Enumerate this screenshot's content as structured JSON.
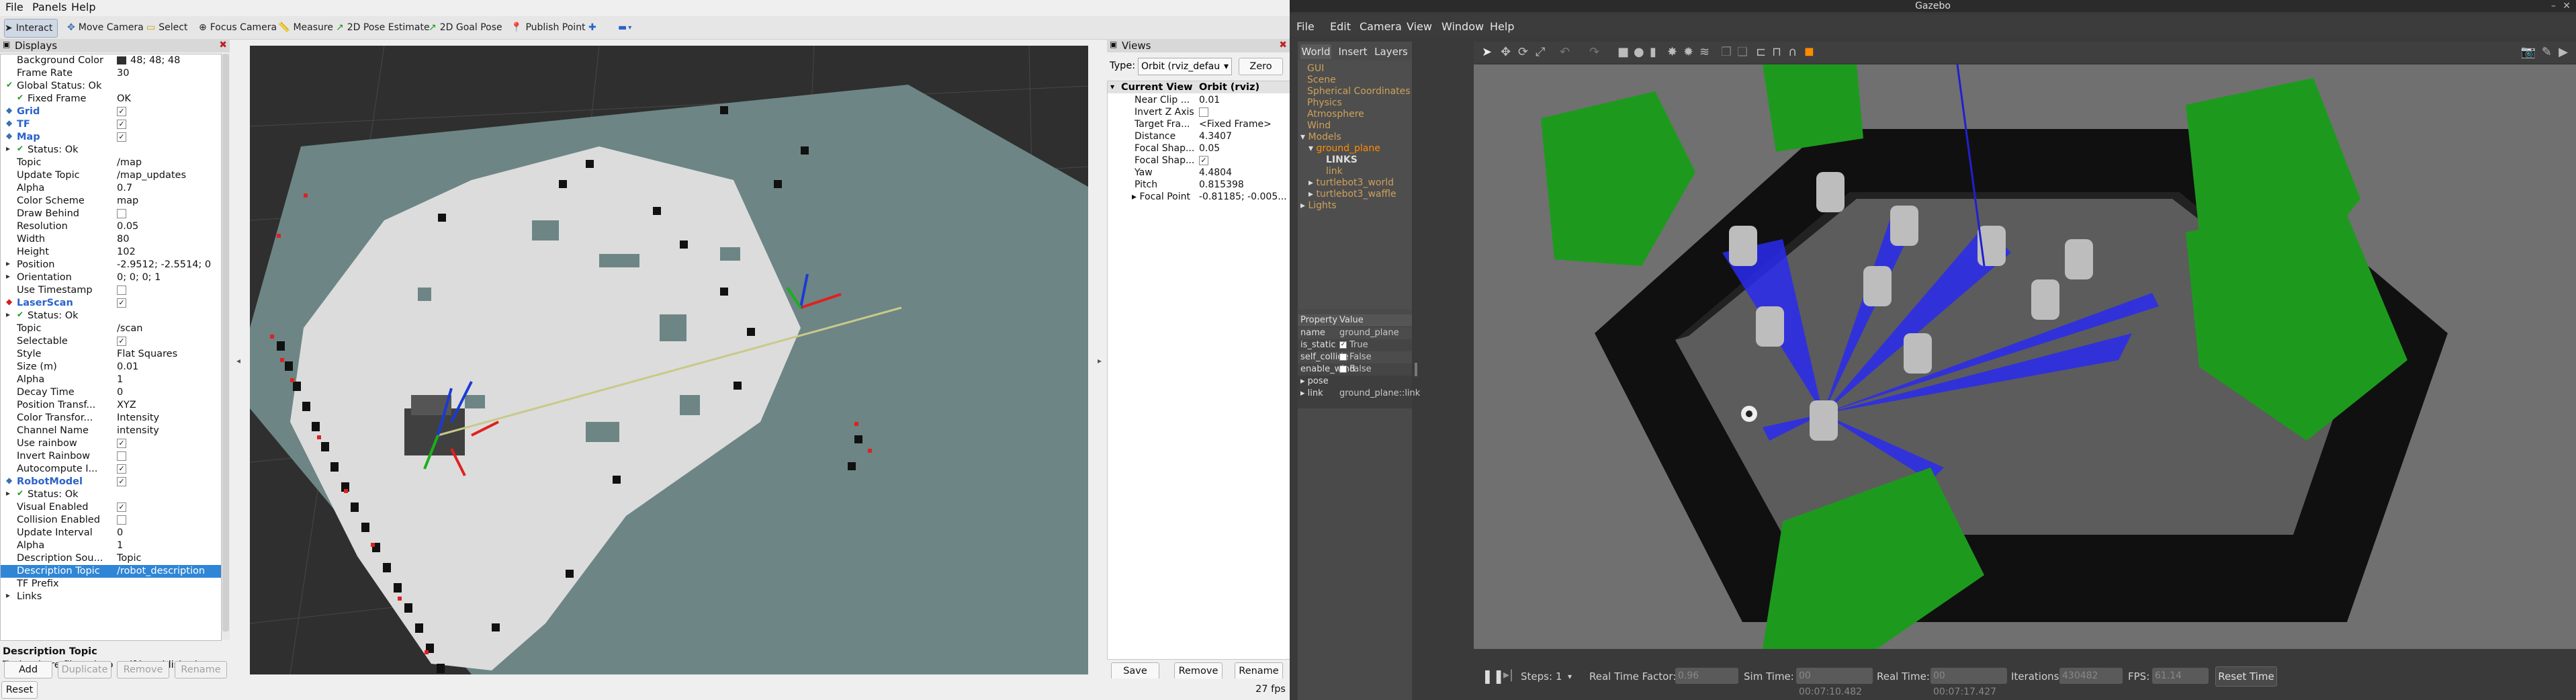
{
  "rviz": {
    "menu": [
      "File",
      "Panels",
      "Help"
    ],
    "tools": [
      {
        "label": "Interact",
        "icon": "cursor-icon",
        "active": true
      },
      {
        "label": "Move Camera",
        "icon": "move-camera-icon"
      },
      {
        "label": "Select",
        "icon": "select-icon"
      },
      {
        "label": "Focus Camera",
        "icon": "focus-camera-icon"
      },
      {
        "label": "Measure",
        "icon": "measure-icon"
      },
      {
        "label": "2D Pose Estimate",
        "icon": "pose-estimate-arrow-icon"
      },
      {
        "label": "2D Goal Pose",
        "icon": "goal-pose-arrow-icon"
      },
      {
        "label": "Publish Point",
        "icon": "map-pin-icon"
      }
    ],
    "displays": {
      "title": "Displays",
      "rows": [
        {
          "key": "Background Color",
          "value": "48; 48; 48",
          "swatch": "#303030"
        },
        {
          "key": "Frame Rate",
          "value": "30"
        },
        {
          "key": "Global Status: Ok",
          "value": ""
        },
        {
          "key": "Fixed Frame",
          "value": "OK"
        },
        {
          "key": "Grid",
          "value": "",
          "checked": true
        },
        {
          "key": "TF",
          "value": "",
          "checked": true
        },
        {
          "key": "Map",
          "value": "",
          "checked": true
        },
        {
          "key": "Status: Ok",
          "value": ""
        },
        {
          "key": "Topic",
          "value": "/map"
        },
        {
          "key": "Update Topic",
          "value": "/map_updates"
        },
        {
          "key": "Alpha",
          "value": "0.7"
        },
        {
          "key": "Color Scheme",
          "value": "map"
        },
        {
          "key": "Draw Behind",
          "value": "",
          "checked": false
        },
        {
          "key": "Resolution",
          "value": "0.05"
        },
        {
          "key": "Width",
          "value": "80"
        },
        {
          "key": "Height",
          "value": "102"
        },
        {
          "key": "Position",
          "value": "-2.9512; -2.5514; 0"
        },
        {
          "key": "Orientation",
          "value": "0; 0; 0; 1"
        },
        {
          "key": "Use Timestamp",
          "value": "",
          "checked": false
        },
        {
          "key": "LaserScan",
          "value": "",
          "checked": true
        },
        {
          "key": "Status: Ok",
          "value": ""
        },
        {
          "key": "Topic",
          "value": "/scan"
        },
        {
          "key": "Selectable",
          "value": "",
          "checked": true
        },
        {
          "key": "Style",
          "value": "Flat Squares"
        },
        {
          "key": "Size (m)",
          "value": "0.01"
        },
        {
          "key": "Alpha",
          "value": "1"
        },
        {
          "key": "Decay Time",
          "value": "0"
        },
        {
          "key": "Position Transf...",
          "value": "XYZ"
        },
        {
          "key": "Color Transfor...",
          "value": "Intensity"
        },
        {
          "key": "Channel Name",
          "value": "intensity"
        },
        {
          "key": "Use rainbow",
          "value": "",
          "checked": true
        },
        {
          "key": "Invert Rainbow",
          "value": "",
          "checked": false
        },
        {
          "key": "Autocompute I...",
          "value": "",
          "checked": true
        },
        {
          "key": "RobotModel",
          "value": "",
          "checked": true
        },
        {
          "key": "Status: Ok",
          "value": ""
        },
        {
          "key": "Visual Enabled",
          "value": "",
          "checked": true
        },
        {
          "key": "Collision Enabled",
          "value": "",
          "checked": false
        },
        {
          "key": "Update Interval",
          "value": "0"
        },
        {
          "key": "Alpha",
          "value": "1"
        },
        {
          "key": "Description Sou...",
          "value": "Topic"
        },
        {
          "key": "Description Topic",
          "value": "/robot_description"
        },
        {
          "key": "TF Prefix",
          "value": ""
        },
        {
          "key": "Links",
          "value": ""
        }
      ],
      "description_title": "Description Topic",
      "description_text": "Topic where filepath to urdf is published.",
      "buttons": [
        "Add",
        "Duplicate",
        "Remove",
        "Rename"
      ]
    },
    "views": {
      "title": "Views",
      "type_label": "Type:",
      "type_value": "Orbit (rviz_defau",
      "zero_label": "Zero",
      "header_key": "Current View",
      "header_value": "Orbit (rviz)",
      "rows": [
        {
          "key": "Near Clip ...",
          "value": "0.01"
        },
        {
          "key": "Invert Z Axis",
          "value": ""
        },
        {
          "key": "Target Fra...",
          "value": "<Fixed Frame>"
        },
        {
          "key": "Distance",
          "value": "4.3407"
        },
        {
          "key": "Focal Shap...",
          "value": "0.05"
        },
        {
          "key": "Focal Shap...",
          "value": ""
        },
        {
          "key": "Yaw",
          "value": "4.4804"
        },
        {
          "key": "Pitch",
          "value": "0.815398"
        },
        {
          "key": "Focal Point",
          "value": "-0.81185; -0.005..."
        }
      ],
      "buttons": [
        "Save",
        "Remove",
        "Rename"
      ]
    },
    "status": {
      "reset_label": "Reset",
      "fps": "27 fps"
    }
  },
  "gazebo": {
    "title": "Gazebo",
    "menu": [
      "File",
      "Edit",
      "Camera",
      "View",
      "Window",
      "Help"
    ],
    "tabs": [
      "World",
      "Insert",
      "Layers"
    ],
    "world_tree": [
      "GUI",
      "Scene",
      "Spherical Coordinates",
      "Physics",
      "Atmosphere",
      "Wind",
      "Models",
      "ground_plane",
      "LINKS",
      "link",
      "turtlebot3_world",
      "turtlebot3_waffle",
      "Lights"
    ],
    "property_header": {
      "key": "Property",
      "value": "Value"
    },
    "properties": [
      {
        "key": "name",
        "value": "ground_plane"
      },
      {
        "key": "is_static",
        "value": "True"
      },
      {
        "key": "self_collide",
        "value": "False"
      },
      {
        "key": "enable_wind",
        "value": "False"
      },
      {
        "key": "pose",
        "value": ""
      },
      {
        "key": "link",
        "value": "ground_plane::link"
      }
    ],
    "bottom": {
      "steps_label": "Steps:",
      "steps_value": "1",
      "rtf_label": "Real Time Factor:",
      "rtf_value": "0.96",
      "sim_time_label": "Sim Time:",
      "sim_time_value": "00 00:07:10.482",
      "real_time_label": "Real Time:",
      "real_time_value": "00 00:07:17.427",
      "iterations_label": "Iterations:",
      "iterations_value": "430482",
      "fps_label": "FPS:",
      "fps_value": "61.14",
      "reset_time_label": "Reset Time"
    }
  }
}
